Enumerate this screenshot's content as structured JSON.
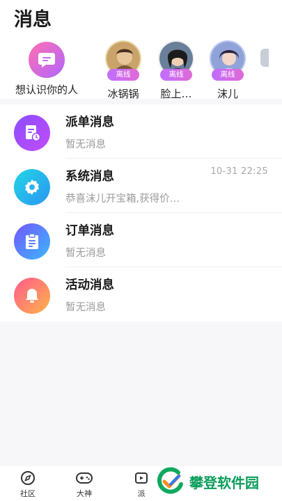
{
  "header": {
    "title": "消息"
  },
  "contacts": [
    {
      "label": "想认识你的人",
      "type": "meet"
    },
    {
      "label": "冰锅锅",
      "status": "离线"
    },
    {
      "label": "脸上…",
      "status": "离线"
    },
    {
      "label": "沫儿",
      "status": "离线"
    }
  ],
  "messages": [
    {
      "title": "派单消息",
      "subtitle": "暂无消息",
      "time": "",
      "icon": "dispatch-icon",
      "color_from": "#7b4dff",
      "color_to": "#c04dff"
    },
    {
      "title": "系统消息",
      "subtitle": "恭喜沫儿开宝箱,获得价…",
      "time": "10-31 22:25",
      "icon": "gear-icon",
      "color_from": "#1fd1e8",
      "color_to": "#2a9df4"
    },
    {
      "title": "订单消息",
      "subtitle": "暂无消息",
      "time": "",
      "icon": "clipboard-icon",
      "color_from": "#6d55ff",
      "color_to": "#38b6ff"
    },
    {
      "title": "活动消息",
      "subtitle": "暂无消息",
      "time": "",
      "icon": "bell-icon",
      "color_from": "#ff5b8a",
      "color_to": "#ffb04a"
    }
  ],
  "tabs": [
    {
      "label": "社区",
      "icon": "compass-icon"
    },
    {
      "label": "大神",
      "icon": "gamepad-icon"
    },
    {
      "label": "派",
      "icon": "play-icon"
    }
  ],
  "watermark": {
    "text": "攀登软件园",
    "color": "#0b9d5a"
  }
}
